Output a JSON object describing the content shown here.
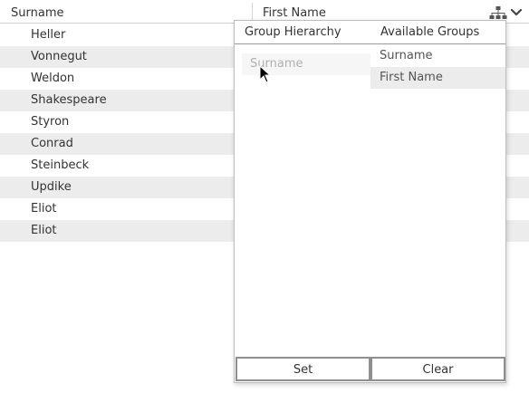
{
  "table": {
    "columns": [
      "Surname",
      "First Name"
    ],
    "rows": [
      "Heller",
      "Vonnegut",
      "Weldon",
      "Shakespeare",
      "Styron",
      "Conrad",
      "Steinbeck",
      "Updike",
      "Eliot",
      "Eliot"
    ]
  },
  "header_icons": [
    "hierarchy-icon",
    "chevron-down-icon"
  ],
  "group_popup": {
    "hierarchy_heading": "Group Hierarchy",
    "available_heading": "Available Groups",
    "hierarchy_items": [
      "Surname"
    ],
    "available_items": [
      "Surname",
      "First Name"
    ],
    "set_label": "Set",
    "clear_label": "Clear"
  },
  "colors": {
    "row_stripe": "#ececec",
    "border": "#bdbdbd",
    "placeholder_text": "#b0b0b0"
  }
}
